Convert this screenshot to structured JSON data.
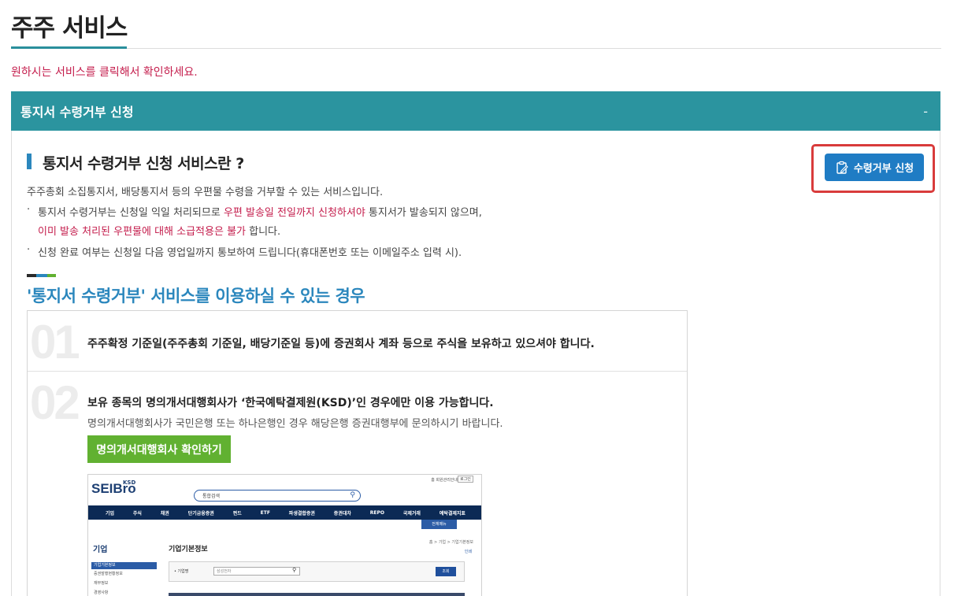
{
  "page": {
    "title": "주주 서비스",
    "guide": "원하시는 서비스를 클릭해서 확인하세요."
  },
  "accordion": {
    "title": "통지서 수령거부 신청",
    "toggle": "-"
  },
  "section": {
    "title": "통지서 수령거부 신청 서비스란 ?",
    "intro": "주주총회 소집통지서, 배당통지서 등의 우편물 수령을 거부할 수 있는 서비스입니다.",
    "bullet1_a": "통지서 수령거부는 신청일 익일 처리되므로 ",
    "bullet1_red": "우편 발송일 전일까지 신청하셔야",
    "bullet1_b": " 통지서가 발송되지 않으며,",
    "bullet1_line2_red": "이미 발송 처리된 우편물에 대해 소급적용은 불가",
    "bullet1_line2_b": " 합니다.",
    "bullet2": "신청 완료 여부는 신청일 다음 영업일까지 통보하여 드립니다(휴대폰번호 또는 이메일주소 입력 시).",
    "bullet_mark": "·"
  },
  "apply_button": {
    "label": "수령거부 신청"
  },
  "usage": {
    "title": "'통지서 수령거부' 서비스를 이용하실 수 있는 경우",
    "cases": [
      {
        "num": "01",
        "text": "주주확정 기준일(주주총회 기준일, 배당기준일 등)에 증권회사 계좌 등으로 주식을 보유하고 있으셔야 합니다."
      },
      {
        "num": "02",
        "text": "보유 종목의 명의개서대행회사가 ‘한국예탁결제원(KSD)’인 경우에만 이용 가능합니다.",
        "sub": "명의개서대행회사가 국민은행 또는 하나은행인 경우 해당은행 증권대행부에 문의하시기 바랍니다."
      }
    ],
    "check_button": "명의개서대행회사 확인하기"
  },
  "mockup": {
    "logo": "SEIBro",
    "logo_ksd": "KSD",
    "search_select": "통합검색",
    "top_links": "홈   회원관리안내",
    "top_button": "로그인",
    "nav": [
      "기업",
      "주식",
      "채권",
      "단기금융증권",
      "펀드",
      "ETF",
      "파생결합증권",
      "증권대차",
      "REPO",
      "국제거래",
      "예탁결제지표"
    ],
    "menu_button": "전체메뉴",
    "lnb_title": "기업",
    "lnb_items": [
      "기업기본정보",
      "증권발행현황정보",
      "재무정보",
      "경영사항"
    ],
    "content_title": "기업기본정보",
    "crumb": "홈 > 기업 > 기업기본정보",
    "print": "인쇄",
    "form_label": "• 기업명",
    "form_value": "삼성전자",
    "form_button": "조회"
  },
  "colors": {
    "accent_teal": "#2b949f",
    "accent_blue": "#2b87bd",
    "highlight_red": "#c41d4c",
    "apply_blue": "#1f7cc4",
    "frame_red": "#d93b3b",
    "green": "#61b131"
  }
}
